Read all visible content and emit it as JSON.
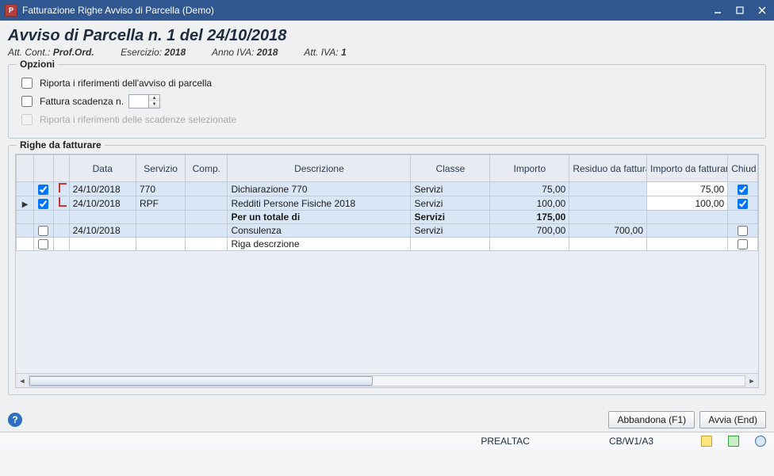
{
  "window": {
    "title": "Fatturazione Righe Avviso di Parcella  (Demo)",
    "app_icon_letter": "P"
  },
  "heading": "Avviso di Parcella n. 1 del 24/10/2018",
  "subhead": {
    "att_cont_label": "Att. Cont.:",
    "att_cont_value": "Prof.Ord.",
    "esercizio_label": "Esercizio:",
    "esercizio_value": "2018",
    "anno_iva_label": "Anno IVA:",
    "anno_iva_value": "2018",
    "att_iva_label": "Att. IVA:",
    "att_iva_value": "1"
  },
  "opzioni": {
    "legend": "Opzioni",
    "riporta_riferimenti": "Riporta i riferimenti dell'avviso di parcella",
    "fattura_scadenza": "Fattura scadenza n.",
    "riporta_scadenze": "Riporta i riferimenti delle scadenze selezionate"
  },
  "righe": {
    "legend": "Righe da fatturare",
    "headers": {
      "data": "Data",
      "servizio": "Servizio",
      "comp": "Comp.",
      "descrizione": "Descrizione",
      "classe": "Classe",
      "importo": "Importo",
      "residuo": "Residuo da fatturare",
      "importo_fatt": "Importo da fatturare",
      "chiudi": "Chiud"
    },
    "rows": [
      {
        "checked": true,
        "group": "first",
        "data": "24/10/2018",
        "servizio": "770",
        "comp": "",
        "descrizione": "Dichiarazione 770",
        "classe": "Servizi",
        "importo": "75,00",
        "residuo": "",
        "importo_fatt": "75,00",
        "chiudi": true
      },
      {
        "checked": true,
        "group": "last",
        "pointer": true,
        "data": "24/10/2018",
        "servizio": "RPF",
        "comp": "",
        "descrizione": "Redditi Persone Fisiche 2018",
        "classe": "Servizi",
        "importo": "100,00",
        "residuo": "",
        "importo_fatt": "100,00",
        "chiudi": true
      },
      {
        "total": true,
        "descrizione": "Per un totale di",
        "classe": "Servizi",
        "importo": "175,00"
      },
      {
        "checked": false,
        "data": "24/10/2018",
        "servizio": "",
        "comp": "",
        "descrizione": "Consulenza",
        "classe": "Servizi",
        "importo": "700,00",
        "residuo": "700,00",
        "importo_fatt": "",
        "chiudi": false
      },
      {
        "checked": false,
        "data": "",
        "servizio": "",
        "comp": "",
        "descrizione": "Riga descrzione",
        "classe": "",
        "importo": "",
        "residuo": "",
        "importo_fatt": "",
        "chiudi": false
      }
    ]
  },
  "footer": {
    "abbandona": "Abbandona (F1)",
    "avvia": "Avvia (End)"
  },
  "status": {
    "left": "PREALTAC",
    "right": "CB/W1/A3"
  }
}
